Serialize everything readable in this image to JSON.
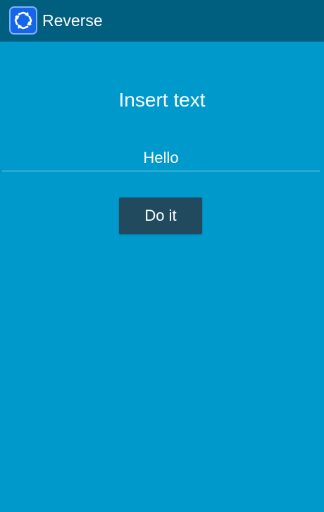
{
  "app_bar": {
    "icon": "reverse-arrows-icon",
    "title": "Reverse",
    "background": "#005f7f"
  },
  "main": {
    "background": "#0099cc",
    "prompt": "Insert text",
    "input": {
      "value": "Hello",
      "placeholder": ""
    },
    "action_button": {
      "label": "Do it",
      "background": "#214a5e"
    }
  }
}
